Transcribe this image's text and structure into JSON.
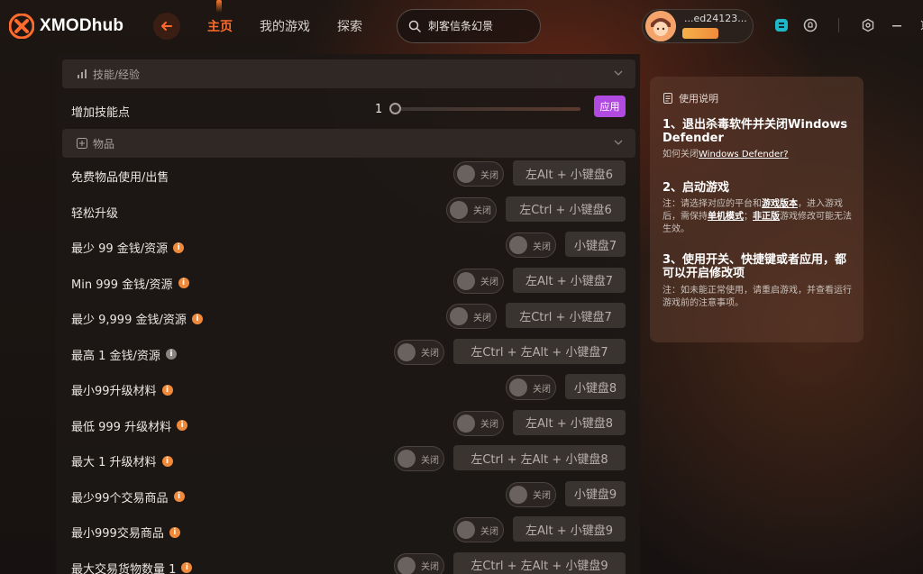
{
  "app": {
    "name": "XMODhub"
  },
  "nav": {
    "tabs": [
      {
        "label": "主页",
        "active": true
      },
      {
        "label": "我的游戏"
      },
      {
        "label": "探索"
      }
    ]
  },
  "search": {
    "placeholder": "刺客信条幻景"
  },
  "user": {
    "name": "...ed24123..."
  },
  "colors": {
    "accent": "#ff6b2d",
    "apply": "#b04ae0",
    "info": "#f08a3a"
  },
  "sections": {
    "skills": {
      "label": "技能/经验"
    },
    "items": {
      "label": "物品"
    }
  },
  "skill_row": {
    "label": "增加技能点",
    "value": "1",
    "apply_label": "应用"
  },
  "toggle_off_label": "关闭",
  "item_rows": [
    {
      "label": "免费物品使用/出售",
      "info": false,
      "hotkey": "左Alt + 小键盘6"
    },
    {
      "label": "轻松升级",
      "info": false,
      "hotkey": "左Ctrl + 小键盘6"
    },
    {
      "label": "最少 99 金钱/资源",
      "info": true,
      "hotkey": "小键盘7"
    },
    {
      "label": "Min 999 金钱/资源",
      "info": true,
      "hotkey": "左Alt + 小键盘7"
    },
    {
      "label": "最少 9,999 金钱/资源",
      "info": true,
      "hotkey": "左Ctrl + 小键盘7"
    },
    {
      "label": "最高 1 金钱/资源",
      "info": "gray",
      "hotkey": "左Ctrl + 左Alt + 小键盘7"
    },
    {
      "label": "最小99升级材料",
      "info": true,
      "hotkey": "小键盘8"
    },
    {
      "label": "最低 999 升级材料",
      "info": true,
      "hotkey": "左Alt + 小键盘8"
    },
    {
      "label": "最大 1 升级材料",
      "info": true,
      "hotkey": "左Ctrl + 左Alt + 小键盘8"
    },
    {
      "label": "最少99个交易商品",
      "info": true,
      "hotkey": "小键盘9"
    },
    {
      "label": "最小999交易商品",
      "info": true,
      "hotkey": "左Alt + 小键盘9"
    },
    {
      "label": "最大交易货物数量 1",
      "info": true,
      "hotkey": "左Ctrl + 左Alt + 小键盘9"
    }
  ],
  "instructions": {
    "title": "使用说明",
    "step1": "1、退出杀毒软件并关闭Windows Defender",
    "step1_sub_prefix": "如何关闭",
    "step1_sub_link": "Windows Defender?",
    "step2": "2、启动游戏",
    "step2_sub_a": "注：请选择对应的平台和",
    "step2_sub_b": "游戏版本",
    "step2_sub_c": "，进入游戏后，需保持",
    "step2_sub_d": "单机模式",
    "step2_sub_e": "；",
    "step2_sub_f": "非正版",
    "step2_sub_g": "游戏修改可能无法生效。",
    "step3": "3、使用开关、快捷键或者应用，都可以开启修改项",
    "step3_sub": "注：如未能正常使用，请重启游戏，并查看运行游戏前的注意事项。"
  }
}
